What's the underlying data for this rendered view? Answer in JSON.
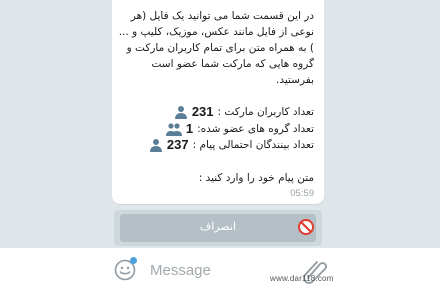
{
  "message": {
    "paragraph": "در این قسمت شما می توانید یک فایل (هر نوعی از فایل مانند عکس، موزیک، کلیپ و ... ) به همراه متن برای تمام کاربران مارکت و گروه هایی که مارکت شما عضو است بفرستید.",
    "stats": [
      {
        "label": "تعداد کاربران مارکت :",
        "value": "231",
        "icon": "user-icon"
      },
      {
        "label": "تعداد گروه های عضو شده:",
        "value": "1",
        "icon": "group-icon"
      },
      {
        "label": "تعداد بینندگان احتمالی پیام :",
        "value": "237",
        "icon": "user-icon"
      }
    ],
    "prompt": "متن پیام خود را وارد کنید :",
    "time": "05:59"
  },
  "keyboard": {
    "cancel_label": "انصراف",
    "cancel_icon": "no-entry-icon"
  },
  "composer": {
    "placeholder": "Message",
    "emoji_icon": "emoji-icon",
    "attach_icon": "attachment-icon",
    "accent": "#4aa3df"
  },
  "watermark": "www.dar118.com"
}
